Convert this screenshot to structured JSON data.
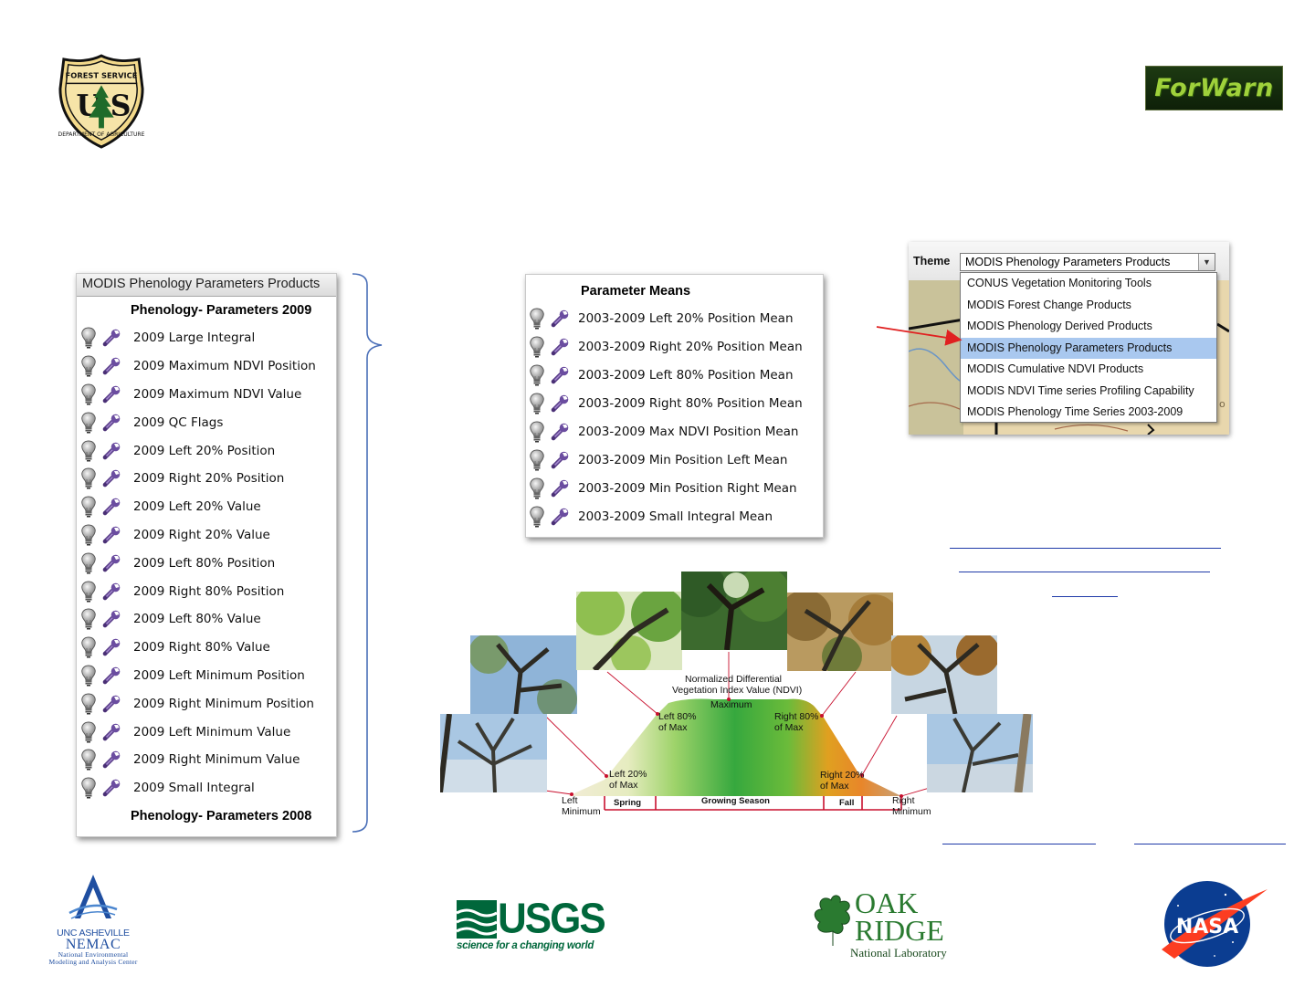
{
  "logos": {
    "usfs": {
      "top": "FOREST SERVICE",
      "letters": "U S",
      "bottom": "DEPARTMENT OF AGRICULTURE"
    },
    "forwarn": "ForWarn",
    "nemac": {
      "line1": "UNC ASHEVILLE",
      "line2": "NEMAC",
      "line3a": "National Environmental",
      "line3b": "Modeling and Analysis Center"
    },
    "usgs": {
      "word": "USGS",
      "tagline": "science for a changing world"
    },
    "ornl": {
      "oak": "OAK",
      "ridge": "RIDGE",
      "lab": "National Laboratory"
    },
    "nasa": "NASA"
  },
  "left_panel": {
    "header": "MODIS Phenology Parameters Products",
    "group_2009": "Phenology- Parameters 2009",
    "items": [
      "2009 Large Integral",
      "2009 Maximum NDVI Position",
      "2009 Maximum NDVI Value",
      "2009 QC Flags",
      "2009 Left 20% Position",
      "2009 Right 20% Position",
      "2009 Left 20% Value",
      "2009 Right 20% Value",
      "2009 Left 80% Position",
      "2009 Right 80% Position",
      "2009 Left 80% Value",
      "2009 Right 80% Value",
      "2009 Left Minimum Position",
      "2009 Right Minimum Position",
      "2009 Left Minimum Value",
      "2009 Right Minimum Value",
      "2009 Small Integral"
    ],
    "group_2008": "Phenology- Parameters 2008"
  },
  "mid_panel": {
    "title": "Parameter Means",
    "items": [
      "2003-2009 Left 20% Position Mean",
      "2003-2009 Right 20% Position Mean",
      "2003-2009 Left 80% Position Mean",
      "2003-2009 Right 80% Position Mean",
      "2003-2009 Max NDVI Position Mean",
      "2003-2009 Min Position Left Mean",
      "2003-2009 Min Position Right Mean",
      "2003-2009 Small Integral Mean"
    ]
  },
  "theme": {
    "label": "Theme",
    "selected": "MODIS Phenology Parameters Products",
    "options": [
      "CONUS Vegetation Monitoring Tools",
      "MODIS Forest Change Products",
      "MODIS Phenology Derived Products",
      "MODIS Phenology Parameters Products",
      "MODIS Cumulative NDVI Products",
      "MODIS NDVI Time series Profiling Capability",
      "MODIS Phenology Time Series 2003-2009"
    ],
    "selected_index": 3
  },
  "diagram": {
    "ndvi_title_1": "Normalized Differential",
    "ndvi_title_2": "Vegetation Index Value (NDVI)",
    "maximum": "Maximum",
    "left80_1": "Left 80%",
    "left80_2": "of Max",
    "right80_1": "Right 80%",
    "right80_2": "of Max",
    "left20_1": "Left 20%",
    "left20_2": "of Max",
    "right20_1": "Right 20%",
    "right20_2": "of Max",
    "leftmin_1": "Left",
    "leftmin_2": "Minimum",
    "rightmin_1": "Right",
    "rightmin_2": "Minimum",
    "spring": "Spring",
    "growing": "Growing Season",
    "fall": "Fall"
  }
}
